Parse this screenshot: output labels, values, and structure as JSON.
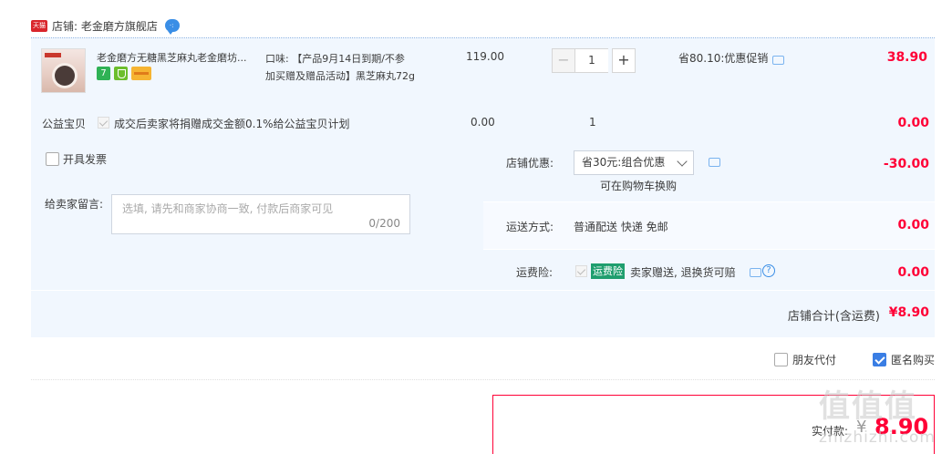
{
  "shop": {
    "badge": "天猫",
    "label": "店铺: 老金磨方旗舰店"
  },
  "item": {
    "title": "老金磨方无糖黑芝麻丸老金磨坊...",
    "spec_line1": "口味: 【产品9月14日到期/不参",
    "spec_line2": "加买赠及赠品活动】黑芝麻丸72g",
    "price": "119.00",
    "quantity": "1",
    "promo": "省80.10:优惠促销",
    "subtotal": "38.90",
    "icons": [
      "seven-day-return-icon",
      "guarantee-shield-icon",
      "credit-card-icon"
    ]
  },
  "charity": {
    "label": "公益宝贝",
    "text": "成交后卖家将捐赠成交金额0.1%给公益宝贝计划",
    "price": "0.00",
    "qty": "1",
    "total": "0.00"
  },
  "invoice": {
    "label": "开具发票",
    "checked": false
  },
  "message": {
    "label": "给卖家留言:",
    "placeholder": "选填, 请先和商家协商一致, 付款后商家可见",
    "count": "0/200"
  },
  "discount": {
    "label": "店铺优惠:",
    "selected": "省30元:组合优惠",
    "sub": "可在购物车换购",
    "amount": "-30.00"
  },
  "shipping": {
    "label": "运送方式:",
    "value": "普通配送 快递 免邮",
    "amount": "0.00"
  },
  "insurance": {
    "label": "运费险:",
    "badge": "运费险",
    "text": "卖家赠送, 退换货可赔",
    "amount": "0.00"
  },
  "shop_total": {
    "label": "店铺合计(含运费)",
    "value": "¥8.90"
  },
  "options": {
    "friend_pay": {
      "label": "朋友代付",
      "checked": false
    },
    "anonymous": {
      "label": "匿名购买",
      "checked": true
    }
  },
  "payment": {
    "label": "实付款:",
    "currency": "¥",
    "value": "8.90"
  },
  "watermark": {
    "glyphs": "值值值",
    "url": "zhizhizhi.com"
  },
  "colors": {
    "accent_red": "#ff0036",
    "panel_blue": "#f1f7fe",
    "link_blue": "#3a8ee6",
    "check_blue": "#3a7ee4"
  }
}
